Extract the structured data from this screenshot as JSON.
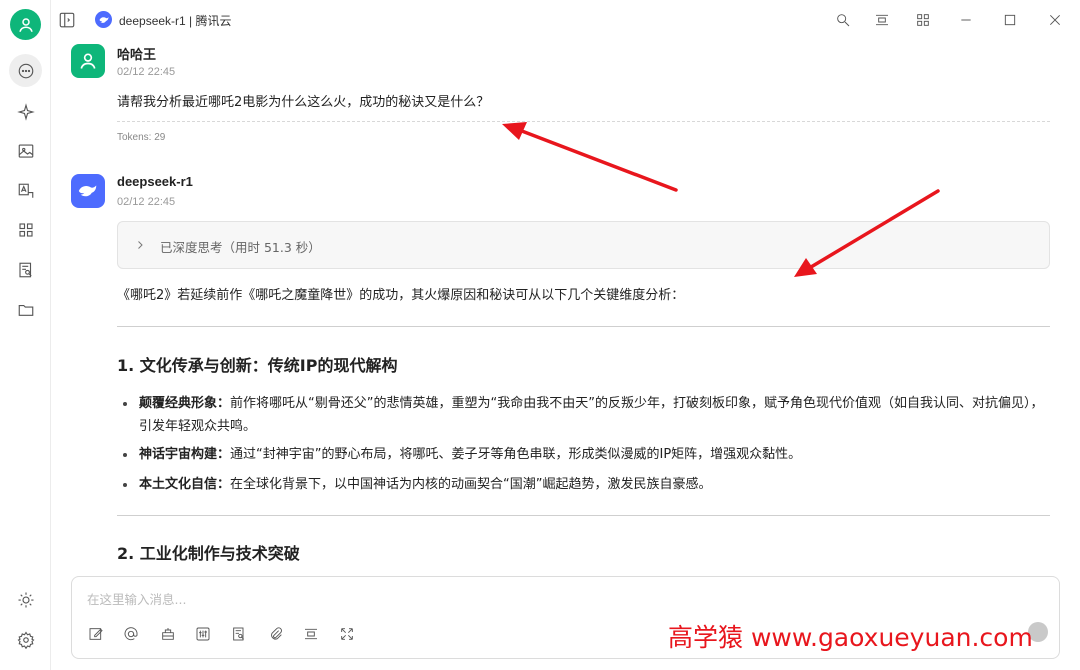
{
  "window": {
    "title": "deepseek-r1 | 腾讯云"
  },
  "sidebar": {
    "items": [
      {
        "icon": "chat-icon",
        "active": true
      },
      {
        "icon": "sparkle-icon"
      },
      {
        "icon": "image-icon"
      },
      {
        "icon": "translate-icon"
      },
      {
        "icon": "apps-grid-icon"
      },
      {
        "icon": "document-search-icon"
      },
      {
        "icon": "folder-icon"
      }
    ],
    "bottom": [
      {
        "icon": "theme-sun-icon"
      },
      {
        "icon": "settings-gear-icon"
      }
    ]
  },
  "messages": {
    "user": {
      "name": "哈哈王",
      "time": "02/12 22:45",
      "text": "请帮我分析最近哪吒2电影为什么这么火，成功的秘诀又是什么？",
      "tokens": "Tokens: 29"
    },
    "assistant": {
      "name": "deepseek-r1",
      "time": "02/12 22:45",
      "thinking": "已深度思考（用时 51.3 秒）",
      "intro": "《哪吒2》若延续前作《哪吒之魔童降世》的成功，其火爆原因和秘诀可从以下几个关键维度分析：",
      "section1": {
        "heading": "1. 文化传承与创新：传统IP的现代解构",
        "bullets": [
          {
            "bold": "颠覆经典形象：",
            "text": "前作将哪吒从“剔骨还父”的悲情英雄，重塑为“我命由我不由天”的反叛少年，打破刻板印象，赋予角色现代价值观（如自我认同、对抗偏见），引发年轻观众共鸣。"
          },
          {
            "bold": "神话宇宙构建：",
            "text": "通过“封神宇宙”的野心布局，将哪吒、姜子牙等角色串联，形成类似漫威的IP矩阵，增强观众黏性。"
          },
          {
            "bold": "本土文化自信：",
            "text": "在全球化背景下，以中国神话为内核的动画契合“国潮”崛起趋势，激发民族自豪感。"
          }
        ]
      },
      "section2": {
        "heading": "2. 工业化制作与技术突破"
      }
    }
  },
  "input": {
    "placeholder": "在这里输入消息..."
  },
  "watermark": "高学猿 www.gaoxueyuan.com",
  "colors": {
    "user_avatar": "#0eb67a",
    "assistant_avatar": "#4d6bfe",
    "annotation_arrow": "#e8161d"
  }
}
